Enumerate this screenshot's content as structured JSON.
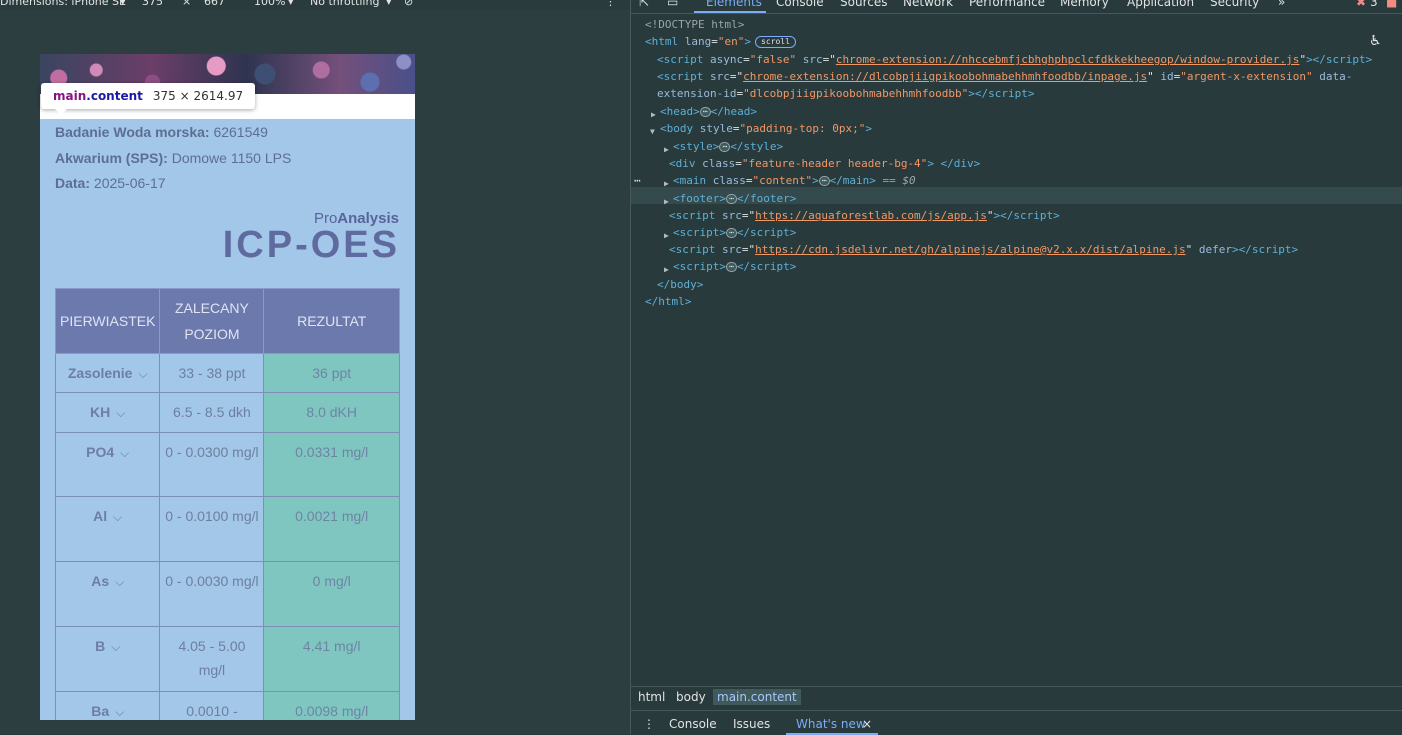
{
  "device_toolbar": {
    "dimensions_label": "Dimensions: iPhone SE",
    "width": "375",
    "height": "667",
    "zoom": "100%",
    "throttling": "No throttling"
  },
  "page": {
    "tooltip": {
      "tag": "main",
      "class": ".content",
      "size": "375 × 2614.97"
    },
    "info": [
      {
        "label": "Badanie Woda morska:",
        "value": "6261549"
      },
      {
        "label": "Akwarium (SPS):",
        "value": "Domowe 1150 LPS"
      },
      {
        "label": "Data:",
        "value": "2025-06-17"
      }
    ],
    "logo": {
      "pro": "Pro",
      "analysis": "Analysis",
      "title": "ICP-OES"
    },
    "table": {
      "headers": [
        "PIERWIASTEK",
        "ZALECANY POZIOM",
        "REZULTAT"
      ],
      "rows": [
        {
          "element": "Zasolenie",
          "recommended": "33 - 38 ppt",
          "result": "36 ppt"
        },
        {
          "element": "KH",
          "recommended": "6.5 - 8.5 dkh",
          "result": "8.0 dKH"
        },
        {
          "element": "PO4",
          "recommended": "0 - 0.0300 mg/l",
          "result": "0.0331 mg/l"
        },
        {
          "element": "Al",
          "recommended": "0 - 0.0100 mg/l",
          "result": "0.0021 mg/l"
        },
        {
          "element": "As",
          "recommended": "0 - 0.0030 mg/l",
          "result": "0 mg/l"
        },
        {
          "element": "B",
          "recommended": "4.05 - 5.00 mg/l",
          "result": "4.41 mg/l"
        },
        {
          "element": "Ba",
          "recommended": "0.0010 -",
          "result": "0.0098 mg/l"
        }
      ],
      "chevron": "⌵"
    }
  },
  "devtools": {
    "tabs": [
      "Elements",
      "Console",
      "Sources",
      "Network",
      "Performance",
      "Memory",
      "Application",
      "Security",
      "»"
    ],
    "error_count": "3",
    "dom": {
      "doctype": "<!DOCTYPE html>",
      "html_open": "html",
      "html_lang_attr": "lang",
      "html_lang_val": "\"en\"",
      "scroll_badge": "scroll",
      "script1_src": "chrome-extension://nhccebmfjcbhghphpclcfdkkekheegop/window-provider.js",
      "script1_async": "\"false\"",
      "script2_src": "chrome-extension://dlcobpjiigpikoobohmabehhmhfoodbb/inpage.js",
      "script2_id": "\"argent-x-extension\"",
      "script2_ext_id": "\"dlcobpjiigpikoobohmabehhmhfoodbb\"",
      "body_style": "\"padding-top: 0px;\"",
      "div_class": "\"feature-header header-bg-4\"",
      "main_class": "\"content\"",
      "selected_marker": "== $0",
      "app_js": "https://aquaforestlab.com/js/app.js",
      "alpine_js": "https://cdn.jsdelivr.net/gh/alpinejs/alpine@v2.x.x/dist/alpine.js"
    },
    "breadcrumbs": [
      "html",
      "body",
      "main.content"
    ],
    "drawer": [
      "Console",
      "Issues",
      "What's new"
    ]
  },
  "colors": {
    "page_bg": "#a3c7e8",
    "table_header": "#6b79ad",
    "result_cell": "#80c6c0",
    "devtools_bg": "#283a3c",
    "accent": "#7cacf8"
  }
}
